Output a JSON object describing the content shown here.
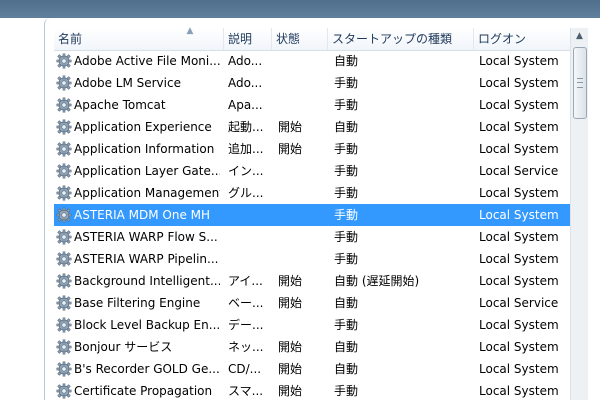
{
  "columns": {
    "name": "名前",
    "description": "説明",
    "status": "状態",
    "startup_type": "スタートアップの種類",
    "logon": "ログオン"
  },
  "sort_indicator": "ascending",
  "icon": "gear-icon",
  "colors": {
    "selected_row": "#3399ff",
    "header_text": "#1e395b"
  },
  "services": [
    {
      "name": "Adobe Active File Moni...",
      "description": "Ado...",
      "status": "",
      "startup_type": "自動",
      "logon": "Local System",
      "selected": false
    },
    {
      "name": "Adobe LM Service",
      "description": "Ado...",
      "status": "",
      "startup_type": "手動",
      "logon": "Local System",
      "selected": false
    },
    {
      "name": "Apache Tomcat",
      "description": "Apa...",
      "status": "",
      "startup_type": "手動",
      "logon": "Local System",
      "selected": false
    },
    {
      "name": "Application Experience",
      "description": "起動...",
      "status": "開始",
      "startup_type": "自動",
      "logon": "Local System",
      "selected": false
    },
    {
      "name": "Application Information",
      "description": "追加...",
      "status": "開始",
      "startup_type": "手動",
      "logon": "Local System",
      "selected": false
    },
    {
      "name": "Application Layer Gate...",
      "description": "イン...",
      "status": "",
      "startup_type": "手動",
      "logon": "Local Service",
      "selected": false
    },
    {
      "name": "Application Management",
      "description": "グル...",
      "status": "",
      "startup_type": "手動",
      "logon": "Local System",
      "selected": false
    },
    {
      "name": "ASTERIA MDM One MH",
      "description": "",
      "status": "",
      "startup_type": "手動",
      "logon": "Local System",
      "selected": true
    },
    {
      "name": "ASTERIA WARP Flow S...",
      "description": "",
      "status": "",
      "startup_type": "手動",
      "logon": "Local System",
      "selected": false
    },
    {
      "name": "ASTERIA WARP Pipelin...",
      "description": "",
      "status": "",
      "startup_type": "手動",
      "logon": "Local System",
      "selected": false
    },
    {
      "name": "Background Intelligent...",
      "description": "アイ...",
      "status": "開始",
      "startup_type": "自動 (遅延開始)",
      "logon": "Local System",
      "selected": false
    },
    {
      "name": "Base Filtering Engine",
      "description": "ベー...",
      "status": "開始",
      "startup_type": "自動",
      "logon": "Local Service",
      "selected": false
    },
    {
      "name": "Block Level Backup En...",
      "description": "デー...",
      "status": "",
      "startup_type": "手動",
      "logon": "Local System",
      "selected": false
    },
    {
      "name": "Bonjour サービス",
      "description": "ネッ...",
      "status": "開始",
      "startup_type": "自動",
      "logon": "Local System",
      "selected": false
    },
    {
      "name": "B's Recorder GOLD Ge...",
      "description": "CD/...",
      "status": "開始",
      "startup_type": "自動",
      "logon": "Local System",
      "selected": false
    },
    {
      "name": "Certificate Propagation",
      "description": "スマ...",
      "status": "開始",
      "startup_type": "手動",
      "logon": "Local System",
      "selected": false
    }
  ]
}
